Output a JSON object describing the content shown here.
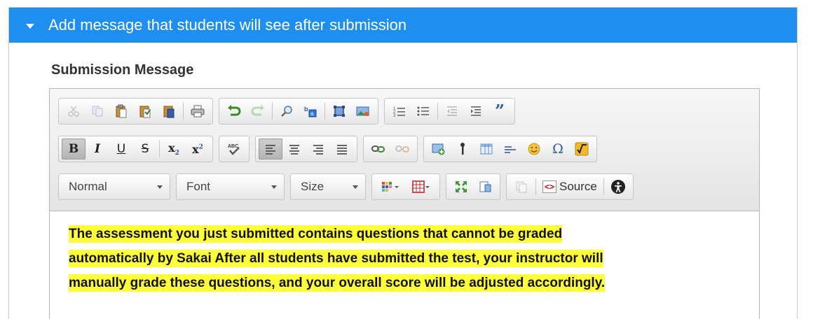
{
  "header": {
    "title": "Add message that students will see after submission"
  },
  "field": {
    "label": "Submission Message"
  },
  "toolbar": {
    "row1": [
      "cut-icon",
      "copy-icon",
      "paste-icon",
      "paste-text-icon",
      "paste-word-icon",
      "print-icon",
      "undo-icon",
      "redo-icon",
      "find-icon",
      "replace-icon",
      "select-all-icon",
      "image-icon",
      "numbered-list-icon",
      "bulleted-list-icon",
      "outdent-icon",
      "indent-icon",
      "blockquote-icon"
    ],
    "bold": "B",
    "italic": "I",
    "underline": "U",
    "strike": "S",
    "subscript": "x",
    "superscript": "x",
    "format_value": "Normal",
    "font_value": "Font",
    "size_value": "Size",
    "source_label": "Source",
    "highlight_color": "#ffff3a",
    "header_color": "#1f8ef1"
  },
  "content": {
    "lines": [
      "The assessment you just submitted contains questions that cannot be graded",
      "automatically by Sakai After all students have submitted the test, your instructor will",
      "manually grade these questions, and your overall score will be adjusted accordingly."
    ]
  }
}
